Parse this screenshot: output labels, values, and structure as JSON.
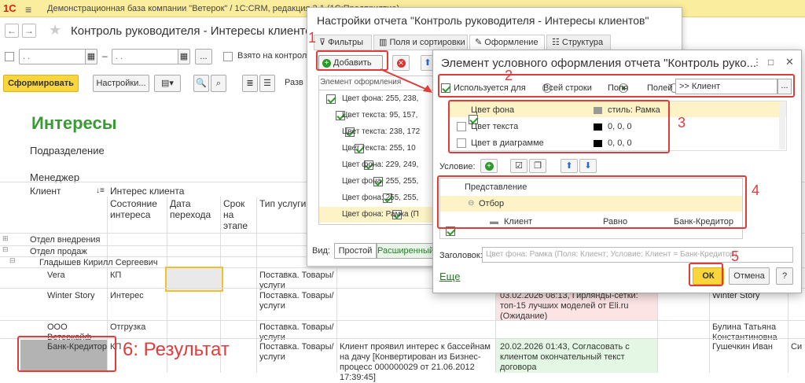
{
  "app": {
    "logo": "1С",
    "title": "Демонстрационная база компании \"Ветерок\" / 1С:CRM, редакция 3.1 (1С:Предприятие)"
  },
  "doc": {
    "title": "Контроль руководителя - Интересы клиентов",
    "nav_back": "←",
    "nav_fwd": "→",
    "date_placeholder": ". .",
    "dash": "–",
    "dots": "...",
    "taken_label": "Взято на контроль",
    "generate_btn": "Сформировать",
    "settings_btn": "Настройки...",
    "expand_label": "Разв"
  },
  "report": {
    "title": "Интересы",
    "dept_label": "Подразделение",
    "manager_label": "Менеджер",
    "client_col": "Клиент",
    "interest_col": "Интерес клиента",
    "state_col": "Состояние интереса",
    "date_col": "Дата перехода",
    "term_col": "Срок на этапе",
    "service_col": "Тип услуги",
    "groups": [
      "Отдел внедрения",
      "Отдел продаж",
      "Гладышев Кирилл Сергеевич"
    ],
    "rows": [
      {
        "client": "Vera",
        "state": "КП",
        "service": "Поставка. Товары/услуги",
        "event": "",
        "responsible": ""
      },
      {
        "client": "Winter Story",
        "state": "Интерес",
        "service": "Поставка. Товары/услуги",
        "event": "03.02.2026 08:13, Гирлянды-сетки: топ-15 лучших моделей от Eli.ru (Ожидание)",
        "responsible": "Winter Story"
      },
      {
        "client": "ООО Ветеркайф",
        "state": "Отгрузка",
        "service": "Поставка. Товары/услуги",
        "event": "",
        "responsible": "Булина Татьяна Константиновна"
      },
      {
        "client": "Банк-Кредитор",
        "state": "КП",
        "service": "Поставка. Товары/услуги",
        "note": "Клиент проявил интерес к бассейнам на дачу [Конвертирован из Бизнес-процесс 000000029 от 21.06.2012 17:39:45]",
        "event": "20.02.2026 01:43, Согласовать с клиентом окончательный текст договора",
        "responsible": "Гушечкин Иван",
        "extra": "Си"
      }
    ],
    "result_label": "6: Результат"
  },
  "dialog1": {
    "title": "Настройки отчета \"Контроль руководителя - Интересы клиентов\"",
    "tabs": [
      "Фильтры",
      "Поля и сортировки",
      "Оформление",
      "Структура"
    ],
    "add_btn": "Добавить",
    "col_header": "Элемент оформления",
    "items": [
      "Цвет фона: 255, 238,",
      "Цвет текста: 95, 157,",
      "Цвет текста: 238, 172",
      "Цвет текста: 255, 10",
      "Цвет фона: 229, 249,",
      "Цвет фона: 255, 255,",
      "Цвет фона: 255, 255,",
      "Цвет фона: Рамка (П"
    ],
    "view_label": "Вид:",
    "simple": "Простой",
    "advanced": "Расширенный"
  },
  "dialog2": {
    "title": "Элемент условного оформления отчета \"Контроль руко...",
    "used_for": "Используется для",
    "all_rows": "Всей строки",
    "fields": "Поля",
    "fields2": "Полей",
    "field_value": ">> Клиент",
    "format_rows": [
      {
        "name": "Цвет фона",
        "value": "стиль: Рамка",
        "checked": true,
        "swatch": "#999999"
      },
      {
        "name": "Цвет текста",
        "value": "0, 0, 0",
        "checked": false,
        "swatch": "#000000"
      },
      {
        "name": "Цвет в диаграмме",
        "value": "0, 0, 0",
        "checked": false,
        "swatch": "#000000"
      }
    ],
    "condition_label": "Условие:",
    "repr_header": "Представление",
    "filter_group": "Отбор",
    "cond_field": "Клиент",
    "cond_op": "Равно",
    "cond_val": "Банк-Кредитор",
    "header_label": "Заголовок:",
    "header_placeholder": "Цвет фона: Рамка (Поля: Клиент; Условие: Клиент = Банк-Кредитор)",
    "more_link": "Еще",
    "ok_btn": "ОК",
    "cancel_btn": "Отмена",
    "help_btn": "?"
  },
  "annotations": [
    "1",
    "2",
    "3",
    "4",
    "5"
  ]
}
